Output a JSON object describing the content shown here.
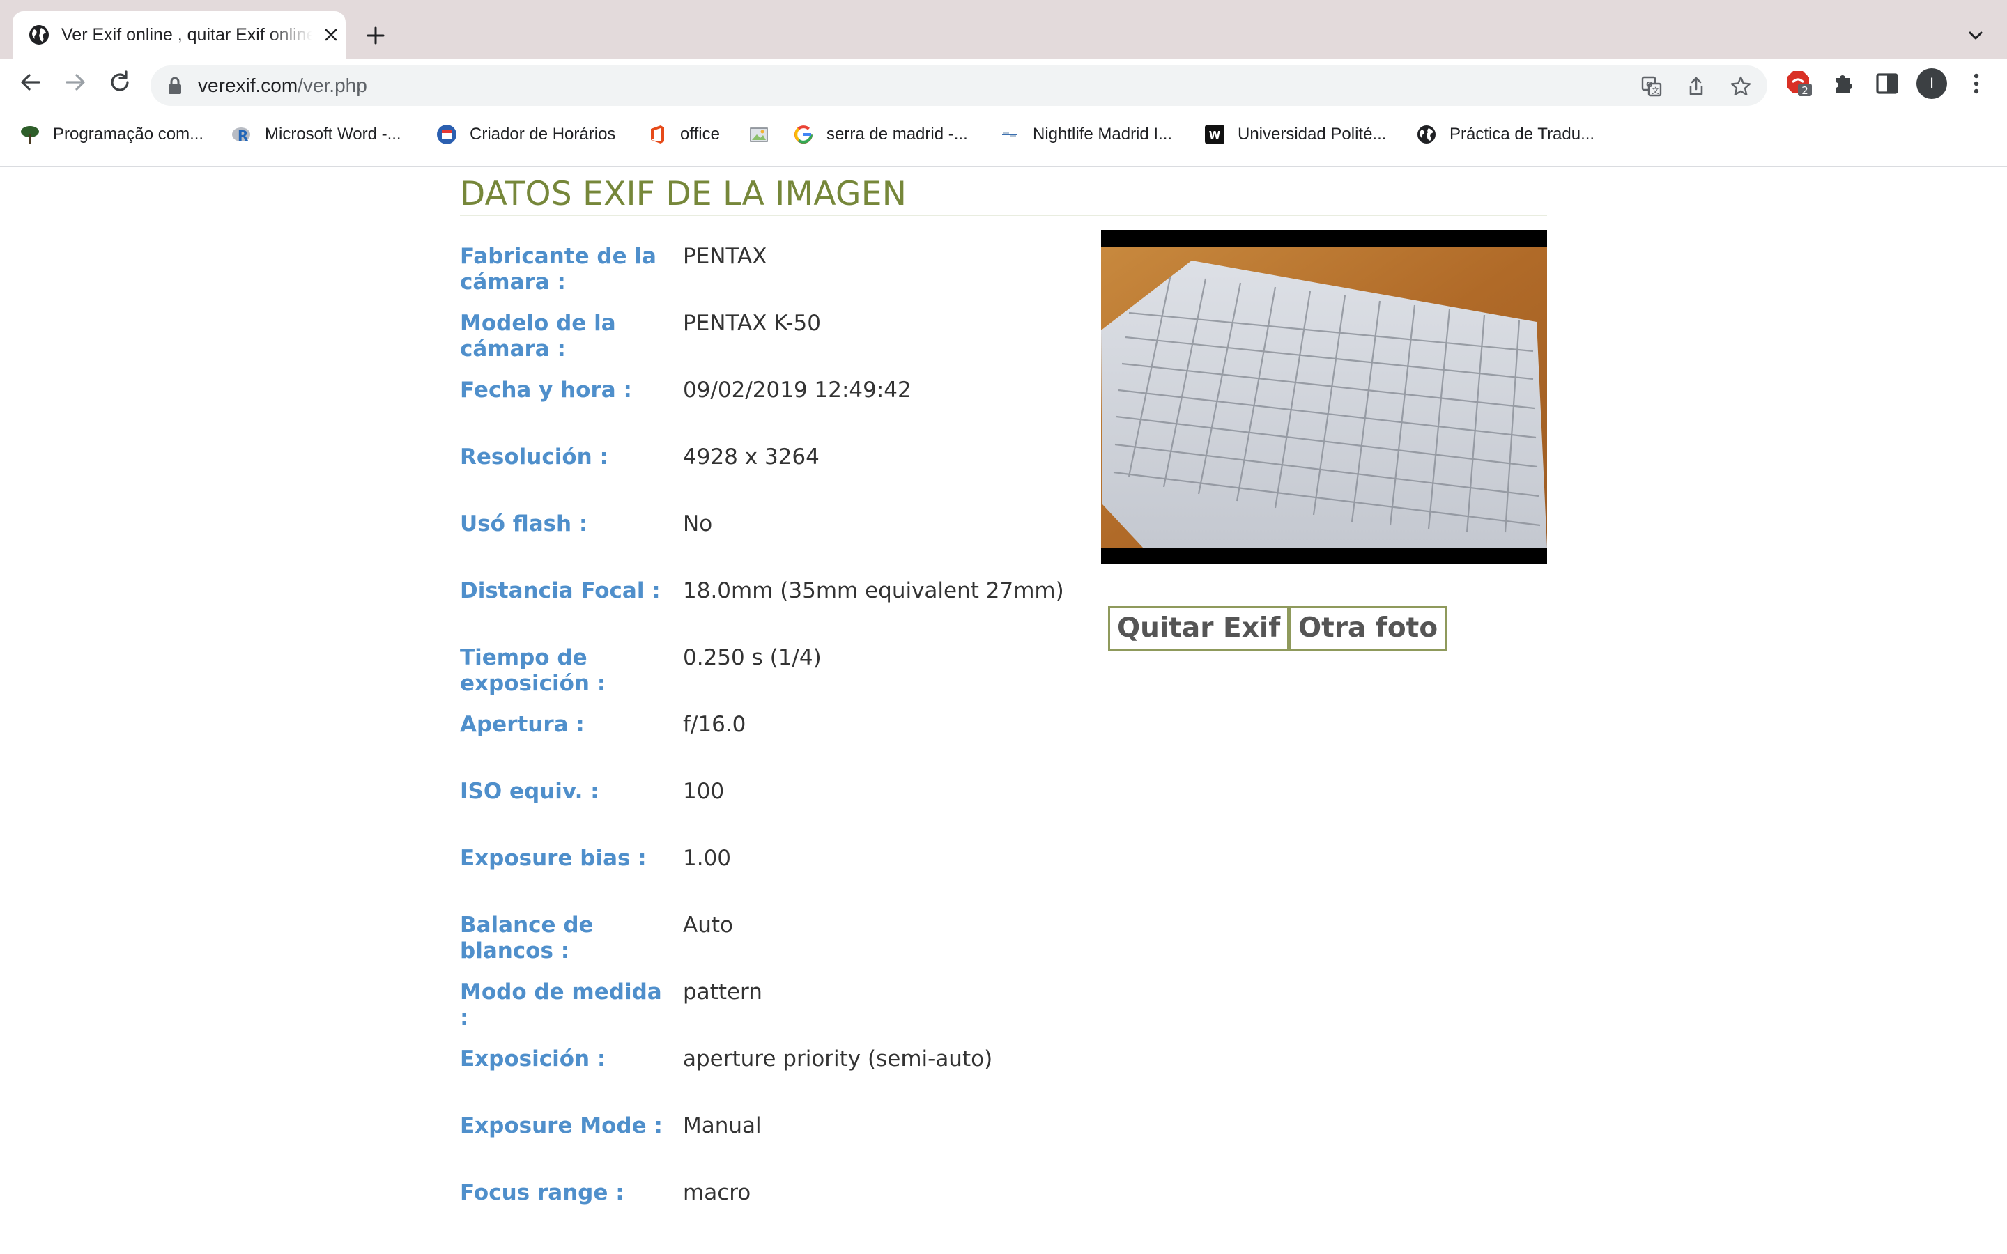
{
  "browser": {
    "tab_title": "Ver Exif online , quitar Exif online",
    "url_domain": "verexif.com",
    "url_path": "/ver.php",
    "avatar_initial": "I",
    "extension_badge": "2"
  },
  "bookmarks": [
    {
      "label": "Programação com...",
      "icon": "tree-icon"
    },
    {
      "label": "Microsoft Word -...",
      "icon": "r-logo-icon"
    },
    {
      "label": "Criador de Horários",
      "icon": "calendar-icon"
    },
    {
      "label": "office",
      "icon": "office-icon"
    },
    {
      "label": "",
      "icon": "image-icon"
    },
    {
      "label": "serra de madrid -...",
      "icon": "google-icon"
    },
    {
      "label": "Nightlife Madrid I...",
      "icon": "site-icon"
    },
    {
      "label": "Universidad Polité...",
      "icon": "w-logo-icon"
    },
    {
      "label": "Práctica de Tradu...",
      "icon": "globe-icon"
    }
  ],
  "page": {
    "heading": "DATOS EXIF DE LA IMAGEN",
    "rows": [
      {
        "label": "Fabricante de la cámara :",
        "value": "PENTAX"
      },
      {
        "label": "Modelo de la cámara :",
        "value": "PENTAX K-50"
      },
      {
        "label": "Fecha y hora :",
        "value": "09/02/2019 12:49:42"
      },
      {
        "label": "Resolución :",
        "value": "4928 x 3264"
      },
      {
        "label": "Usó flash :",
        "value": "No"
      },
      {
        "label": "Distancia Focal :",
        "value": "18.0mm (35mm equivalent 27mm)"
      },
      {
        "label": "Tiempo de exposición :",
        "value": "0.250 s (1/4)"
      },
      {
        "label": "Apertura :",
        "value": "f/16.0"
      },
      {
        "label": "ISO equiv. :",
        "value": "100"
      },
      {
        "label": "Exposure bias :",
        "value": "1.00"
      },
      {
        "label": "Balance de blancos :",
        "value": "Auto"
      },
      {
        "label": "Modo de medida :",
        "value": "pattern"
      },
      {
        "label": "Exposición :",
        "value": "aperture priority (semi-auto)"
      },
      {
        "label": "Exposure Mode :",
        "value": "Manual"
      },
      {
        "label": "Focus range :",
        "value": "macro"
      }
    ],
    "buttons": {
      "remove_exif": "Quitar Exif",
      "other_photo": "Otra foto"
    }
  },
  "colors": {
    "heading": "#76873a",
    "label": "#4f8fcb",
    "value": "#333333",
    "button_border": "#8f9a5c"
  }
}
